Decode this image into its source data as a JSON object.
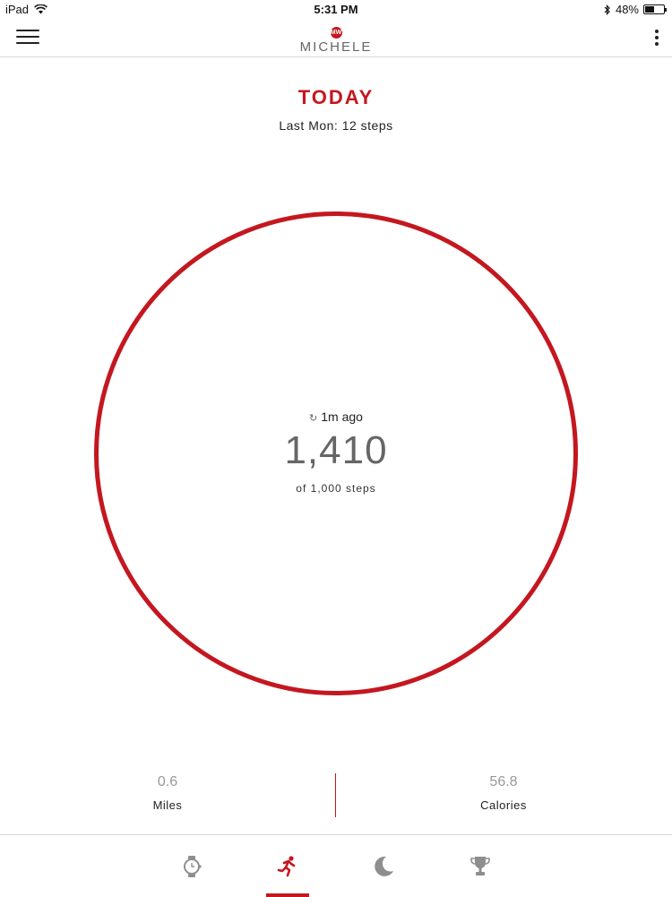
{
  "status_bar": {
    "device": "iPad",
    "time": "5:31 PM",
    "battery": "48%",
    "battery_level": 0.48
  },
  "header": {
    "brand": "MICHELE",
    "logo_text": "MW"
  },
  "summary": {
    "title": "TODAY",
    "last_period": "Last Mon: 12 steps"
  },
  "progress": {
    "sync_time": "1m ago",
    "steps": "1,410",
    "goal_text": "of 1,000 steps"
  },
  "stats": {
    "miles_value": "0.6",
    "miles_label": "Miles",
    "calories_value": "56.8",
    "calories_label": "Calories"
  },
  "tabs": [
    {
      "name": "watch",
      "icon": "watch-icon"
    },
    {
      "name": "activity",
      "icon": "running-icon",
      "active": true
    },
    {
      "name": "sleep",
      "icon": "moon-icon"
    },
    {
      "name": "goals",
      "icon": "trophy-icon"
    }
  ],
  "colors": {
    "accent": "#c4171f",
    "inactive_icon": "#8e8e8e"
  }
}
